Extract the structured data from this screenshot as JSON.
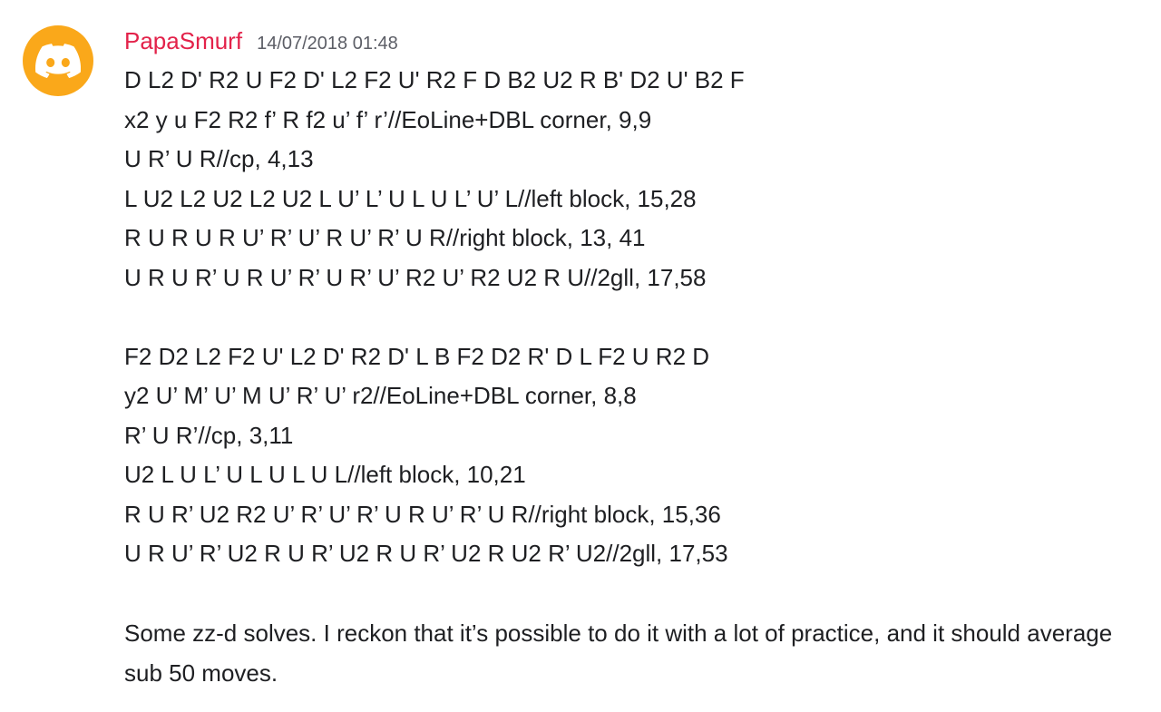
{
  "message": {
    "avatar_icon": "discord-logo-icon",
    "avatar_color": "#faa81a",
    "username": "PapaSmurf",
    "username_color": "#e3224a",
    "timestamp": "14/07/2018 01:48",
    "solve1": [
      "D L2 D' R2 U F2 D' L2 F2 U' R2 F D B2 U2 R B' D2 U' B2 F",
      "x2 y u F2 R2 f’ R f2 u’ f’ r’//EoLine+DBL corner, 9,9",
      "U R’ U R//cp, 4,13",
      "L U2 L2 U2 L2 U2 L U’ L’ U L U L’ U’ L//left block, 15,28",
      "R U R U R U’ R’ U’ R U’ R’ U R//right block, 13, 41",
      "U R U R’ U R U’ R’ U R’ U’ R2 U’ R2 U2 R U//2gll, 17,58"
    ],
    "solve2": [
      "F2 D2 L2 F2 U' L2 D' R2 D' L B F2 D2 R' D L F2 U R2 D",
      "y2 U’ M’ U’ M U’ R’ U’ r2//EoLine+DBL corner, 8,8",
      "R’ U R’//cp, 3,11",
      "U2 L U L’ U L U L U L//left block, 10,21",
      "R U R’ U2 R2 U’ R’ U’ R’ U R U’ R’ U R//right block, 15,36",
      "U R U’ R’ U2 R U R’ U2 R U R’ U2 R U2 R’ U2//2gll, 17,53"
    ],
    "comment": "Some zz-d solves. I reckon that it’s possible to do it with a lot of practice, and it should average sub 50 moves."
  }
}
